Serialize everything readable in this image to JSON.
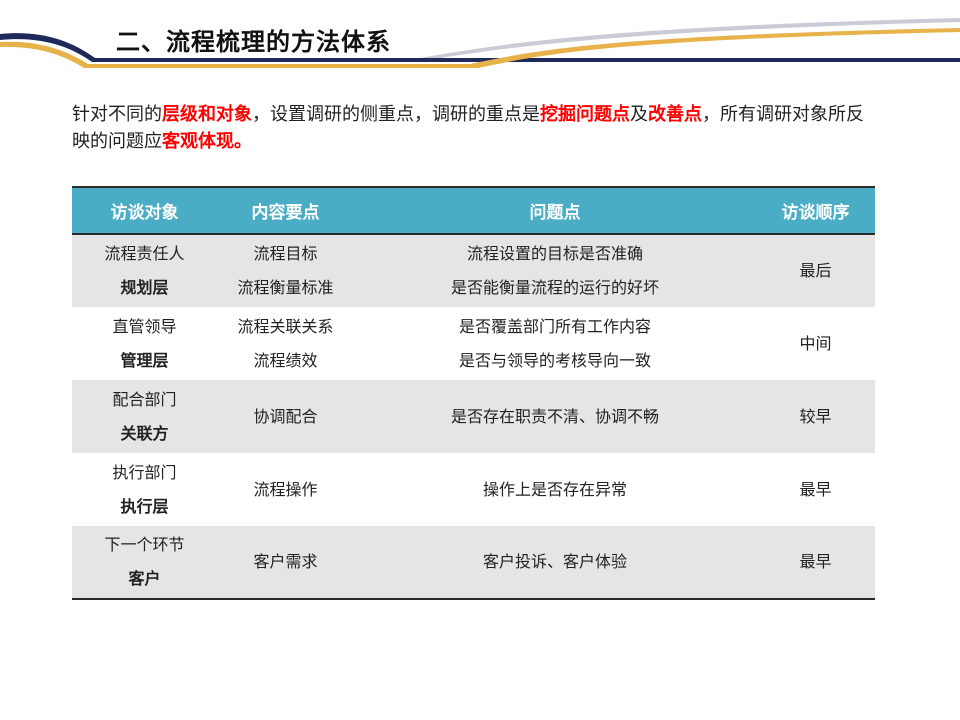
{
  "slide": {
    "title": "二、流程梳理的方法体系"
  },
  "intro": {
    "p1": "针对不同的",
    "h1": "层级和对象",
    "p2": "，设置调研的侧重点，调研的重点是",
    "h2": "挖掘问题点",
    "p3": "及",
    "h3": "改善点",
    "p4": "，所有调研对象所反映的问题应",
    "h4": "客观体现。"
  },
  "table": {
    "headers": [
      "访谈对象",
      "内容要点",
      "问题点",
      "访谈顺序"
    ],
    "rows": [
      {
        "object": "流程责任人",
        "level": "规划层",
        "content": [
          "流程目标",
          "流程衡量标准"
        ],
        "issues": [
          "流程设置的目标是否准确",
          "是否能衡量流程的运行的好坏"
        ],
        "order": "最后"
      },
      {
        "object": "直管领导",
        "level": "管理层",
        "content": [
          "流程关联关系",
          "流程绩效"
        ],
        "issues": [
          "是否覆盖部门所有工作内容",
          "是否与领导的考核导向一致"
        ],
        "order": "中间"
      },
      {
        "object": "配合部门",
        "level": "关联方",
        "content": [
          "协调配合"
        ],
        "issues": [
          "是否存在职责不清、协调不畅"
        ],
        "order": "较早"
      },
      {
        "object": "执行部门",
        "level": "执行层",
        "content": [
          "流程操作"
        ],
        "issues": [
          "操作上是否存在异常"
        ],
        "order": "最早"
      },
      {
        "object": "下一个环节",
        "level": "客户",
        "content": [
          "客户需求"
        ],
        "issues": [
          "客户投诉、客户体验"
        ],
        "order": "最早"
      }
    ]
  },
  "colors": {
    "header_bg": "#4bacc6",
    "row_grey": "#e5e5e5",
    "highlight": "#ff0000",
    "deco_navy": "#1f2a5a",
    "deco_gold": "#e8b24a"
  }
}
